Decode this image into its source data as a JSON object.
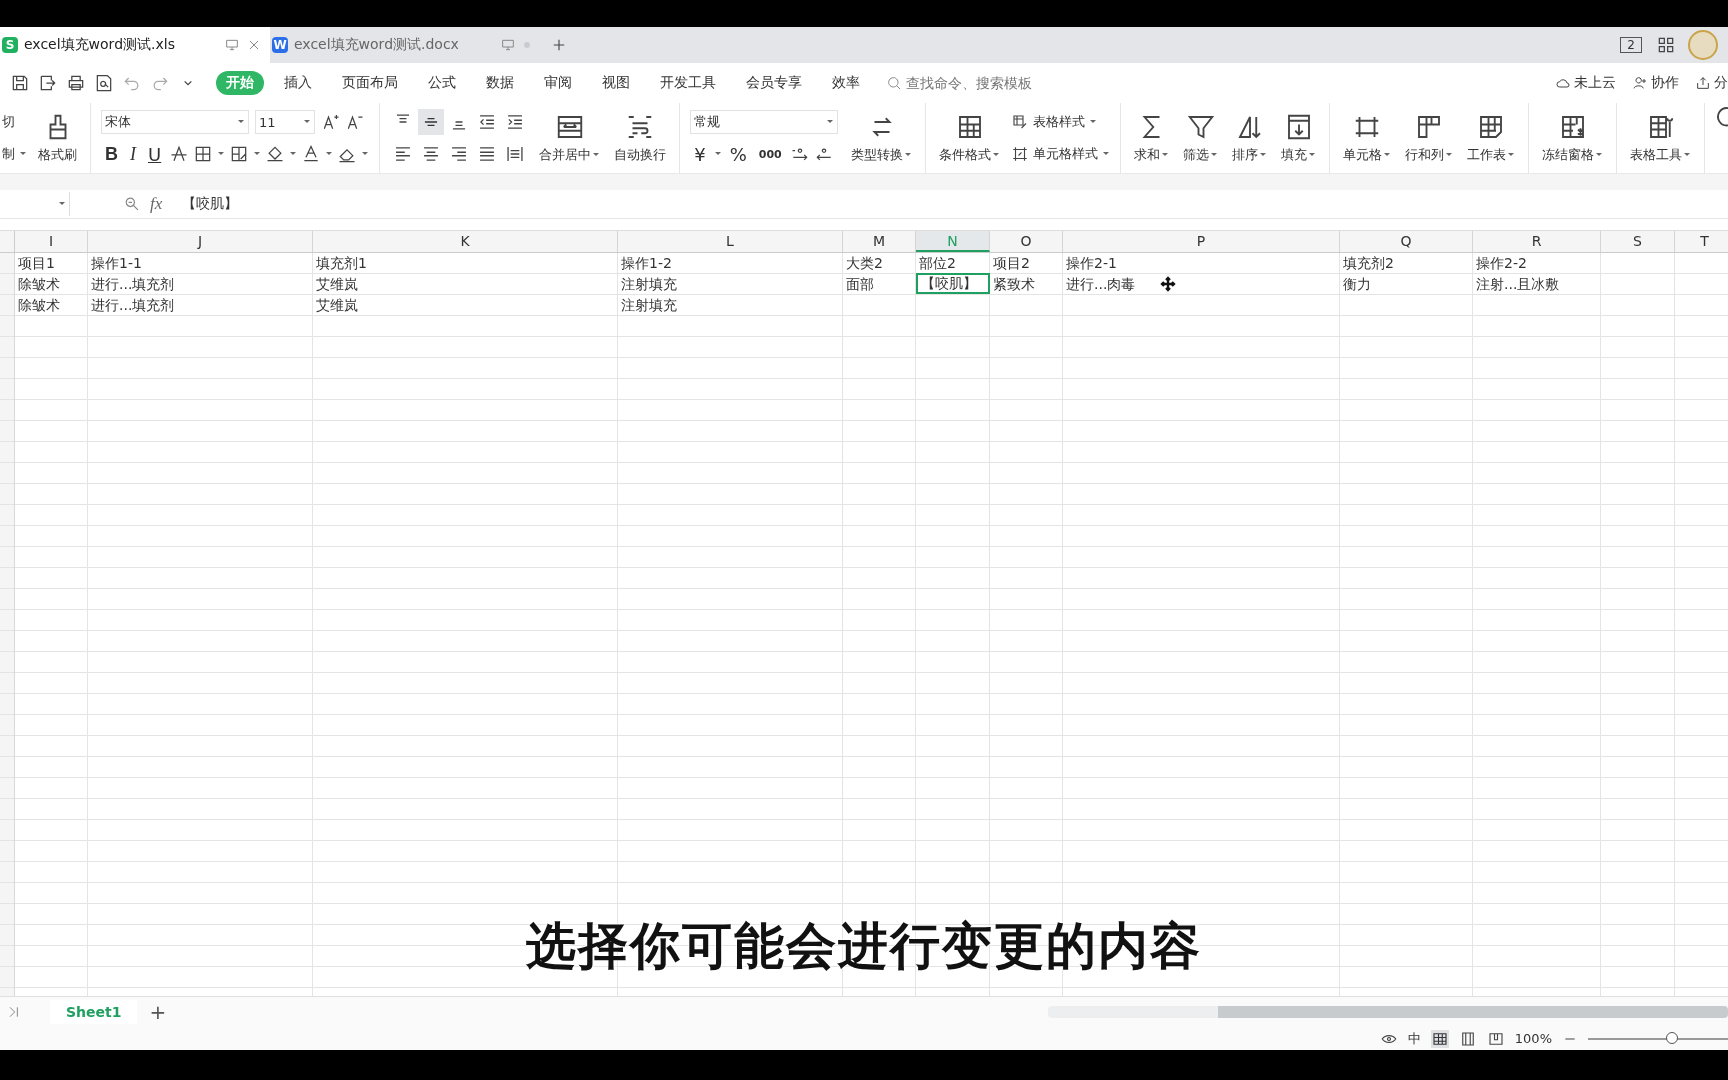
{
  "tabs": [
    {
      "badge": "S",
      "kind": "sheet",
      "title": "excel填充word测试.xls",
      "selected": true
    },
    {
      "badge": "W",
      "kind": "doc",
      "title": "excel填充word测试.docx",
      "selected": false
    }
  ],
  "window_count": "2",
  "menu": [
    {
      "label": "开始",
      "selected": true
    },
    {
      "label": "插入",
      "selected": false
    },
    {
      "label": "页面布局",
      "selected": false
    },
    {
      "label": "公式",
      "selected": false
    },
    {
      "label": "数据",
      "selected": false
    },
    {
      "label": "审阅",
      "selected": false
    },
    {
      "label": "视图",
      "selected": false
    },
    {
      "label": "开发工具",
      "selected": false
    },
    {
      "label": "会员专享",
      "selected": false
    },
    {
      "label": "效率",
      "selected": false
    }
  ],
  "search": {
    "placeholder": "查找命令、搜索模板"
  },
  "menu_actions": [
    "未上云",
    "协作",
    "分"
  ],
  "ribbon": {
    "clipboard": [
      "切",
      "制"
    ],
    "format_painter": "格式刷",
    "font": {
      "name": "宋体",
      "size": "11"
    },
    "format_glyphs": [
      "B",
      "I",
      "U"
    ],
    "alignment": [
      {
        "selected": false
      },
      {
        "selected": true
      },
      {
        "selected": false
      },
      {
        "selected": false
      },
      {
        "selected": false
      },
      {
        "selected": false
      },
      {
        "selected": false
      },
      {
        "selected": false
      },
      {
        "selected": false
      },
      {
        "selected": false
      }
    ],
    "merge": "合并居中",
    "wrap": "自动换行",
    "number_format": "常规",
    "number_glyphs": [
      "¥",
      "%",
      "000"
    ],
    "convert": "类型转换",
    "conditional": "条件格式",
    "styles": [
      "表格样式",
      "单元格样式"
    ],
    "tools": [
      "求和",
      "筛选",
      "排序",
      "填充",
      "单元格",
      "行和列",
      "工作表",
      "冻结窗格",
      "表格工具"
    ]
  },
  "formula_bar": {
    "value": "【咬肌】"
  },
  "fx": "fx",
  "columns": [
    {
      "label": "I",
      "selected": false
    },
    {
      "label": "J",
      "selected": false
    },
    {
      "label": "K",
      "selected": false
    },
    {
      "label": "L",
      "selected": false
    },
    {
      "label": "M",
      "selected": false
    },
    {
      "label": "N",
      "selected": true
    },
    {
      "label": "O",
      "selected": false
    },
    {
      "label": "P",
      "selected": false
    },
    {
      "label": "Q",
      "selected": false
    },
    {
      "label": "R",
      "selected": false
    },
    {
      "label": "S",
      "selected": false
    },
    {
      "label": "T",
      "selected": false
    }
  ],
  "rows": [
    {
      "cells": [
        {
          "text": "项目1",
          "selected": false
        },
        {
          "text": "操作1-1",
          "selected": false
        },
        {
          "text": "填充剂1",
          "selected": false
        },
        {
          "text": "操作1-2",
          "selected": false
        },
        {
          "text": "大类2",
          "selected": false
        },
        {
          "text": "部位2",
          "selected": false
        },
        {
          "text": "项目2",
          "selected": false
        },
        {
          "text": "操作2-1",
          "selected": false
        },
        {
          "text": "填充剂2",
          "selected": false
        },
        {
          "text": "操作2-2",
          "selected": false
        }
      ]
    },
    {
      "cells": [
        {
          "text": "除皱术",
          "selected": false
        },
        {
          "text": "进行...填充剂",
          "selected": false
        },
        {
          "text": "艾维岚",
          "selected": false
        },
        {
          "text": "注射填充",
          "selected": false
        },
        {
          "text": "面部",
          "selected": false
        },
        {
          "text": "【咬肌】",
          "selected": true
        },
        {
          "text": "紧致术",
          "selected": false
        },
        {
          "text": "进行...肉毒",
          "selected": false
        },
        {
          "text": "衡力",
          "selected": false
        },
        {
          "text": "注射...且冰敷",
          "selected": false
        }
      ]
    },
    {
      "cells": [
        {
          "text": "除皱术",
          "selected": false
        },
        {
          "text": "进行...填充剂",
          "selected": false
        },
        {
          "text": "艾维岚",
          "selected": false
        },
        {
          "text": "注射填充",
          "selected": false
        }
      ]
    }
  ],
  "sheets": [
    {
      "label": "Sheet1",
      "selected": true
    }
  ],
  "add_sheet": "+",
  "status_bar": {
    "input_mode": "中",
    "zoom": "100%",
    "zoom_slider": {
      "level": 0.6
    }
  },
  "subtitle": "选择你可能会进行变更的内容"
}
